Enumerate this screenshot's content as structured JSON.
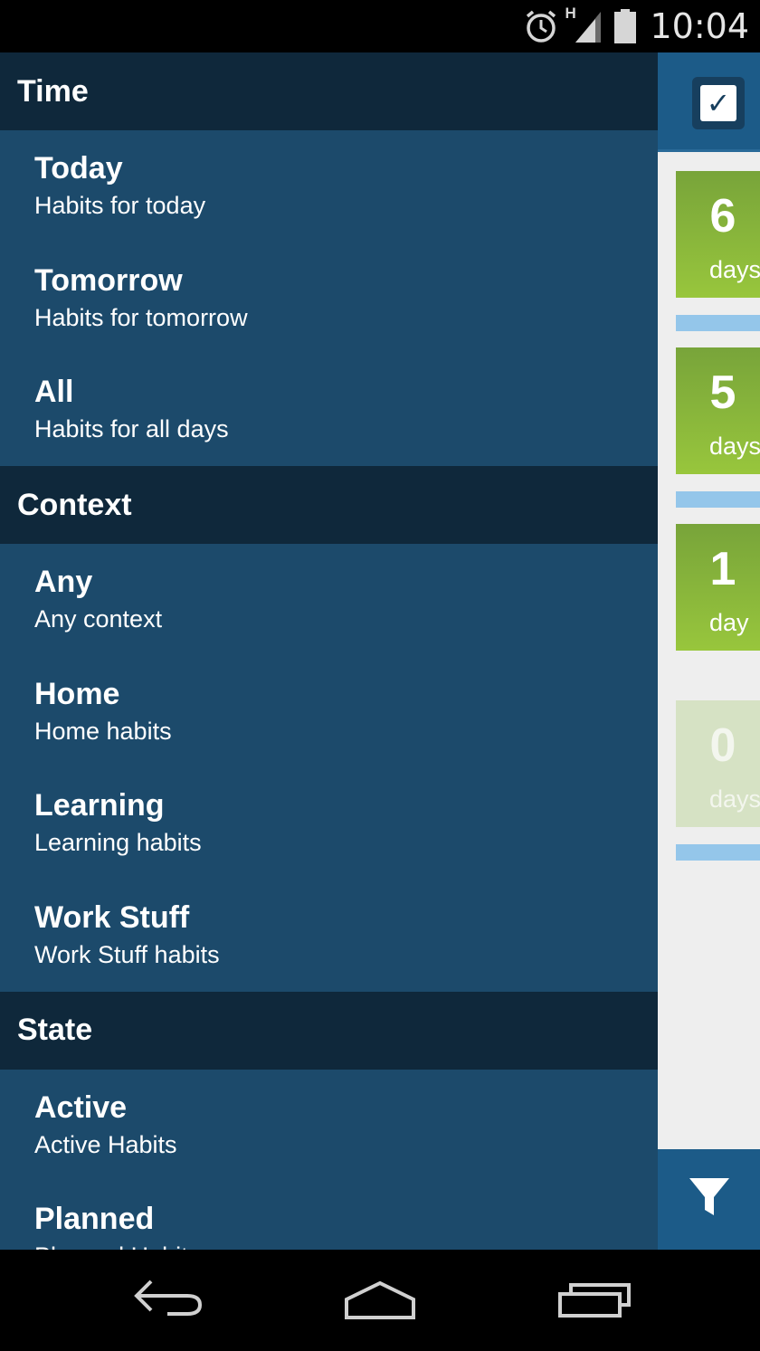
{
  "status_bar": {
    "time": "10:04",
    "network_label": "H",
    "icons": [
      "alarm-icon",
      "signal-icon",
      "battery-icon"
    ]
  },
  "drawer": {
    "sections": [
      {
        "header": "Time",
        "items": [
          {
            "title": "Today",
            "subtitle": "Habits for today"
          },
          {
            "title": "Tomorrow",
            "subtitle": "Habits for tomorrow"
          },
          {
            "title": "All",
            "subtitle": "Habits for all days"
          }
        ]
      },
      {
        "header": "Context",
        "items": [
          {
            "title": "Any",
            "subtitle": "Any context"
          },
          {
            "title": "Home",
            "subtitle": "Home habits"
          },
          {
            "title": "Learning",
            "subtitle": "Learning habits"
          },
          {
            "title": "Work Stuff",
            "subtitle": "Work Stuff habits"
          }
        ]
      },
      {
        "header": "State",
        "items": [
          {
            "title": "Active",
            "subtitle": "Active Habits"
          },
          {
            "title": "Planned",
            "subtitle": "Planned Habits"
          }
        ]
      }
    ]
  },
  "background_app": {
    "streaks": [
      {
        "count": "6",
        "unit": "days"
      },
      {
        "count": "5",
        "unit": "days"
      },
      {
        "count": "1",
        "unit": "day"
      },
      {
        "count": "0",
        "unit": "days"
      }
    ],
    "icons": [
      "checkbox-icon",
      "filter-icon"
    ]
  },
  "colors": {
    "drawer_bg": "#1c4a6b",
    "section_header_bg": "#0f283b",
    "action_bar": "#1c5b88",
    "streak_green": "#8ab83c",
    "streak_faded": "#d6e2c4",
    "progress_blue": "#94c6ea"
  }
}
